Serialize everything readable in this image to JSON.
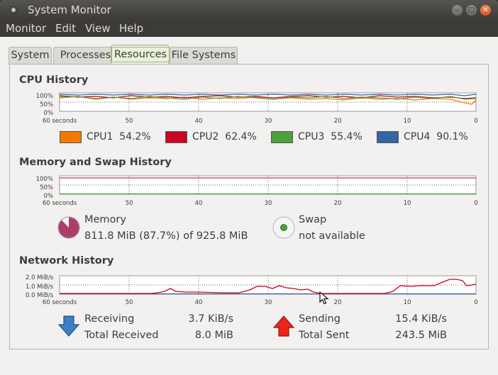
{
  "window": {
    "title": "System Monitor"
  },
  "menu": [
    "Monitor",
    "Edit",
    "View",
    "Help"
  ],
  "tabs": [
    {
      "label": "System"
    },
    {
      "label": "Processes"
    },
    {
      "label": "Resources",
      "active": true
    },
    {
      "label": "File Systems"
    }
  ],
  "cpu": {
    "title": "CPU History",
    "y_ticks": [
      "100%",
      "50%",
      "0%"
    ],
    "x_ticks": [
      "60 seconds",
      "50",
      "40",
      "30",
      "20",
      "10",
      "0"
    ],
    "legend": [
      {
        "name": "CPU1",
        "value": "54.2%",
        "color": "#f57900"
      },
      {
        "name": "CPU2",
        "value": "62.4%",
        "color": "#cc0025"
      },
      {
        "name": "CPU3",
        "value": "55.4%",
        "color": "#4ba23c"
      },
      {
        "name": "CPU4",
        "value": "90.1%",
        "color": "#3465a4"
      }
    ]
  },
  "memory": {
    "title": "Memory and Swap History",
    "y_ticks": [
      "100%",
      "50%",
      "0%"
    ],
    "x_ticks": [
      "60 seconds",
      "50",
      "40",
      "30",
      "20",
      "10",
      "0"
    ],
    "memory_label": "Memory",
    "memory_value": "811.8 MiB (87.7%) of 925.8 MiB",
    "memory_fraction": 0.877,
    "memory_color": "#ad3e6c",
    "swap_label": "Swap",
    "swap_value": "not available",
    "swap_color": "#4ba23c"
  },
  "network": {
    "title": "Network History",
    "y_ticks": [
      "2.0 MiB/s",
      "1.0 MiB/s",
      "0.0 MiB/s"
    ],
    "x_ticks": [
      "60 seconds",
      "50",
      "40",
      "30",
      "20",
      "10",
      "0"
    ],
    "receiving_label": "Receiving",
    "receiving_value": "3.7 KiB/s",
    "total_received_label": "Total Received",
    "total_received_value": "8.0 MiB",
    "sending_label": "Sending",
    "sending_value": "15.4 KiB/s",
    "total_sent_label": "Total Sent",
    "total_sent_value": "243.5 MiB",
    "receiving_color": "#3465a4",
    "sending_color": "#cc0025"
  }
}
